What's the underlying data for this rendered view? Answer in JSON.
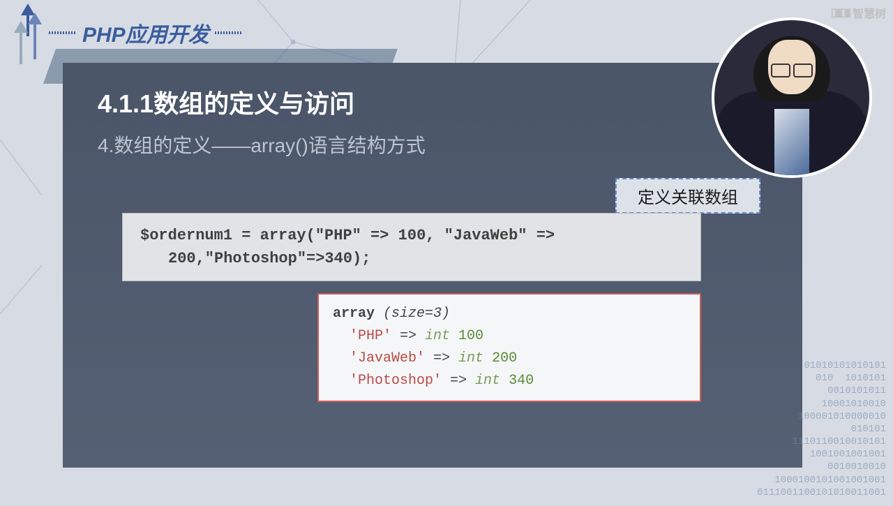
{
  "header": {
    "title": "PHP应用开发"
  },
  "watermark": {
    "text": "智慧树"
  },
  "slide": {
    "section_title": "4.1.1数组的定义与访问",
    "subtitle": "4.数组的定义——array()语言结构方式",
    "label": "定义关联数组",
    "code1_l1": "$ordernum1 = array(\"PHP\" => 100, \"JavaWeb\" =>",
    "code1_l2": "200,\"Photoshop\"=>340);",
    "output": {
      "header_kw": "array ",
      "header_size": "(size=3)",
      "rows": [
        {
          "key": "'PHP'",
          "arrow": " => ",
          "type": "int ",
          "val": "100"
        },
        {
          "key": "'JavaWeb'",
          "arrow": " => ",
          "type": "int ",
          "val": "200"
        },
        {
          "key": "'Photoshop'",
          "arrow": " => ",
          "type": "int ",
          "val": "340"
        }
      ]
    }
  },
  "binary_lines": "01010101010101\n010  1010101\n0010101011\n10001010010\n100001010000010\n010101\n1110110010010101\n1001001001001\n0010010010\n1000100101001001001\n0111001100101010011001"
}
